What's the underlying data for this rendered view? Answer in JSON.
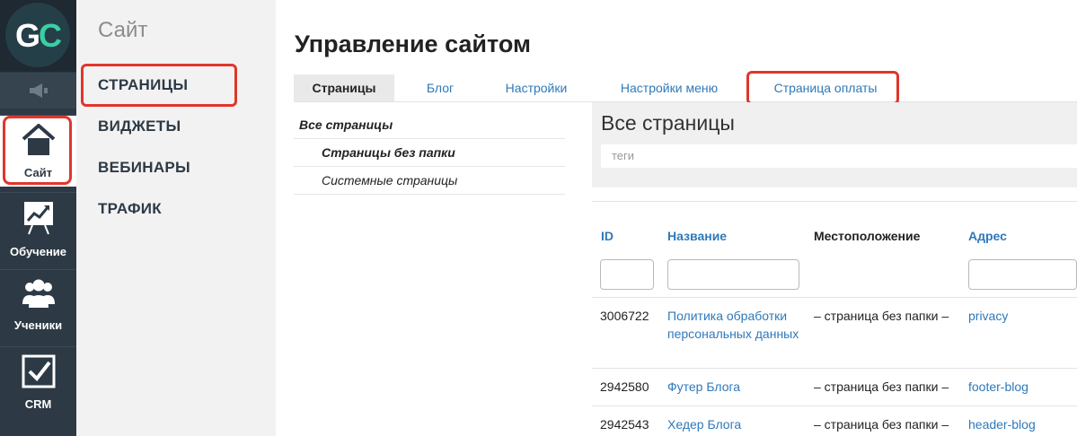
{
  "logo": {
    "g": "G",
    "c": "C"
  },
  "rail": {
    "items": [
      {
        "label": "Сайт",
        "icon": "house-icon",
        "active": true
      },
      {
        "label": "Обучение",
        "icon": "chart-board-icon",
        "active": false
      },
      {
        "label": "Ученики",
        "icon": "people-icon",
        "active": false
      },
      {
        "label": "CRM",
        "icon": "checkbox-icon",
        "active": false
      }
    ]
  },
  "submenu": {
    "title": "Сайт",
    "items": [
      "СТРАНИЦЫ",
      "ВИДЖЕТЫ",
      "ВЕБИНАРЫ",
      "ТРАФИК"
    ]
  },
  "main": {
    "title": "Управление сайтом",
    "tabs": [
      "Страницы",
      "Блог",
      "Настройки",
      "Настройки меню",
      "Страница оплаты"
    ],
    "active_tab": "Страницы"
  },
  "folders": {
    "root": "Все страницы",
    "items": [
      "Страницы без папки",
      "Системные страницы"
    ]
  },
  "content": {
    "title": "Все страницы",
    "tags_placeholder": "теги"
  },
  "table": {
    "headers": {
      "id": "ID",
      "name": "Название",
      "location": "Местоположение",
      "address": "Адрес"
    },
    "rows": [
      {
        "id": "3006722",
        "name": "Политика обработки персональных данных",
        "location": "– страница без папки –",
        "address": "privacy"
      },
      {
        "id": "2942580",
        "name": "Футер Блога",
        "location": "– страница без папки –",
        "address": "footer-blog"
      },
      {
        "id": "2942543",
        "name": "Хедер Блога",
        "location": "– страница без папки –",
        "address": "header-blog"
      }
    ]
  },
  "colors": {
    "rail": "#2d3a46",
    "accent_green": "#39d0a4",
    "link": "#2f79b9",
    "highlight": "#e0362c"
  }
}
